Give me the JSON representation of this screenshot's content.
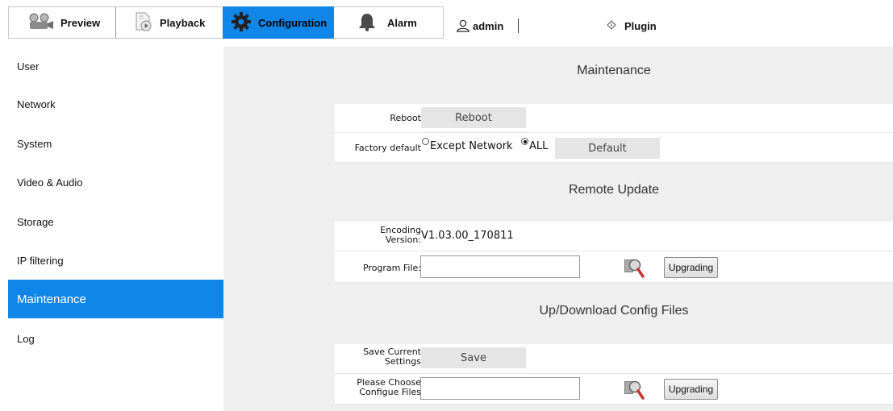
{
  "topnav": {
    "preview": "Preview",
    "playback": "Playback",
    "configuration": "Configuration",
    "alarm": "Alarm",
    "user": "admin",
    "plugin": "Plugin"
  },
  "colors": {
    "accent": "#0f86e8",
    "panel": "#efefef"
  },
  "sidebar": {
    "items": [
      {
        "label": "User"
      },
      {
        "label": "Network"
      },
      {
        "label": "System"
      },
      {
        "label": "Video & Audio"
      },
      {
        "label": "Storage"
      },
      {
        "label": "IP filtering"
      },
      {
        "label": "Maintenance",
        "active": true
      },
      {
        "label": "Log"
      }
    ]
  },
  "maintenance": {
    "title": "Maintenance",
    "reboot_label": "Reboot",
    "reboot_button": "Reboot",
    "factory_label": "Factory default",
    "option_except": "Except Network",
    "option_all": "ALL",
    "selected_option": "ALL",
    "default_button": "Default"
  },
  "remote_update": {
    "title": "Remote Update",
    "version_label": "Encoding Version:",
    "version_label_line1": "Encoding",
    "version_label_line2": "Version:",
    "version_value": "V1.03.00_170811",
    "program_file_label": "Program File:",
    "program_file_value": "",
    "upgrade_button": "Upgrading"
  },
  "config_files": {
    "title": "Up/Download Config Files",
    "save_label_line1": "Save Current",
    "save_label_line2": "Settings",
    "save_button": "Save",
    "choose_label_line1": "Please Choose",
    "choose_label_line2": "Configue Files",
    "choose_file_value": "",
    "upgrade_button": "Upgrading"
  },
  "icons": {
    "preview": "camera-icon",
    "playback": "playback-file-icon",
    "configuration": "gear-icon",
    "alarm": "bell-icon",
    "user": "user-icon",
    "plugin": "plugin-icon",
    "browse": "magnifier-browse-icon"
  }
}
